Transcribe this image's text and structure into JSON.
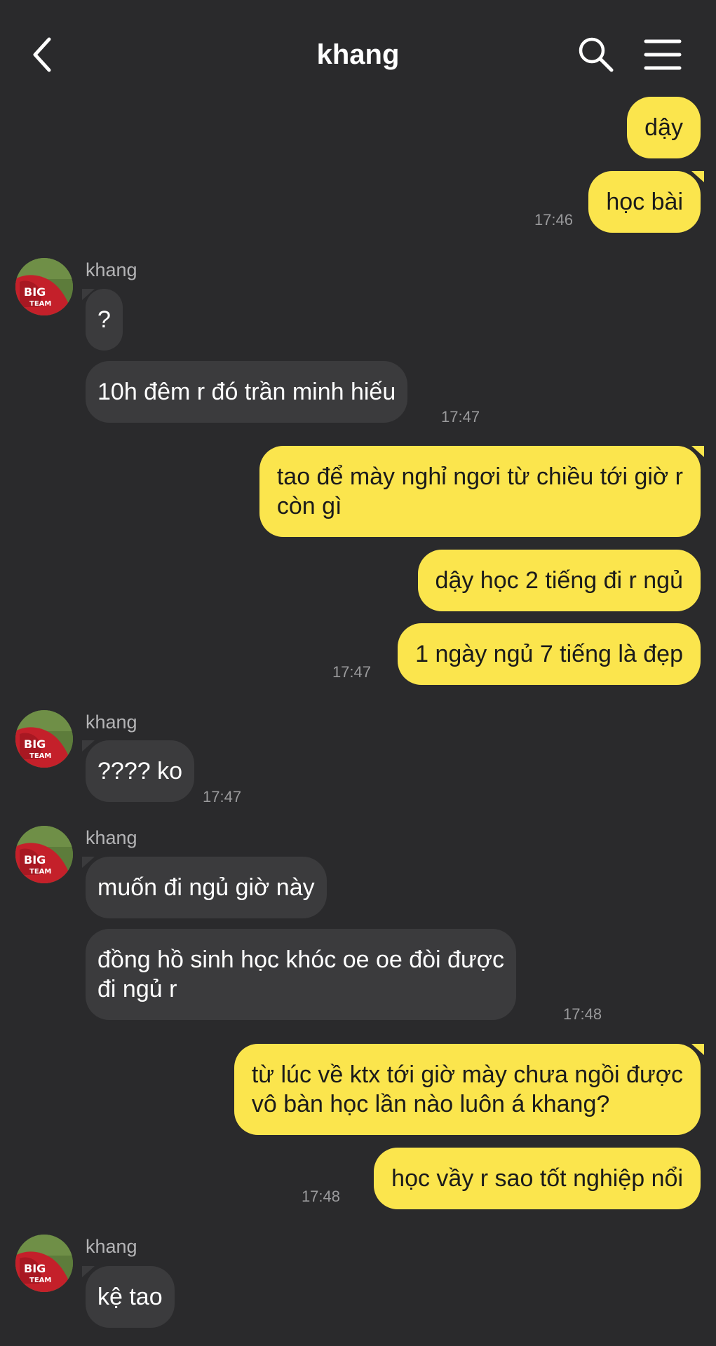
{
  "header": {
    "title": "khang",
    "back_icon": "chevron-left-icon",
    "search_icon": "search-icon",
    "menu_icon": "hamburger-menu-icon"
  },
  "colors": {
    "background": "#2a2a2c",
    "outgoing_bubble": "#fbe54d",
    "incoming_bubble": "#3b3b3d",
    "timestamp": "#9a9a9c"
  },
  "messages": [
    {
      "dir": "out",
      "text": "dậy"
    },
    {
      "dir": "out",
      "text": "học bài",
      "time": "17:46"
    },
    {
      "dir": "in",
      "sender": "khang",
      "text": "?"
    },
    {
      "dir": "in",
      "text": "10h đêm r đó trần minh hiếu",
      "time": "17:47"
    },
    {
      "dir": "out",
      "text": "tao để mày nghỉ ngơi từ chiều tới giờ r\ncòn gì"
    },
    {
      "dir": "out",
      "text": "dậy học 2 tiếng đi r ngủ"
    },
    {
      "dir": "out",
      "text": "1 ngày ngủ 7 tiếng là đẹp",
      "time": "17:47"
    },
    {
      "dir": "in",
      "sender": "khang",
      "text": "???? ko",
      "time": "17:47"
    },
    {
      "dir": "in",
      "sender": "khang",
      "text": "muốn đi ngủ giờ này"
    },
    {
      "dir": "in",
      "text": "đồng hồ sinh học khóc oe oe đòi được\nđi ngủ r",
      "time": "17:48"
    },
    {
      "dir": "out",
      "text": "từ lúc về ktx tới giờ mày chưa ngồi được\nvô bàn học lần nào luôn á khang?"
    },
    {
      "dir": "out",
      "text": "học vầy r sao tốt nghiệp nổi",
      "time": "17:48"
    },
    {
      "dir": "in",
      "sender": "khang",
      "text": "kệ tao"
    }
  ]
}
